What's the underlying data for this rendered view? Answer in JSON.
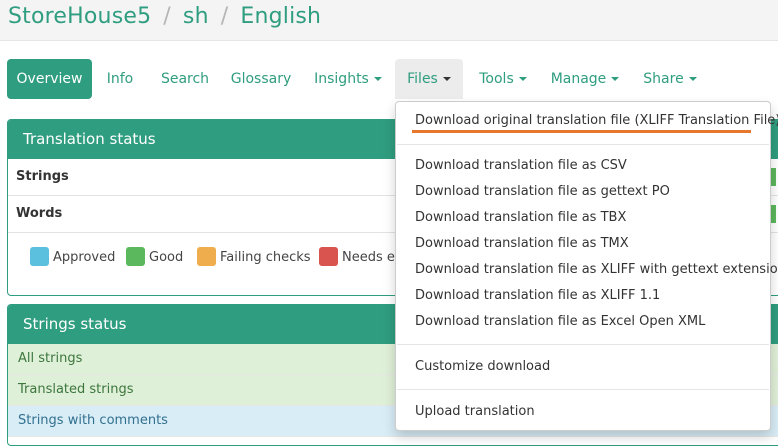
{
  "breadcrumb": {
    "project": "StoreHouse5",
    "component": "sh",
    "language": "English",
    "separator": "/"
  },
  "tabs": [
    {
      "label": "Overview"
    },
    {
      "label": "Info"
    },
    {
      "label": "Search"
    },
    {
      "label": "Glossary"
    },
    {
      "label": "Insights"
    },
    {
      "label": "Files"
    },
    {
      "label": "Tools"
    },
    {
      "label": "Manage"
    },
    {
      "label": "Share"
    }
  ],
  "translation_status": {
    "title": "Translation status",
    "rows": [
      {
        "label": "Strings"
      },
      {
        "label": "Words"
      }
    ],
    "legend": [
      {
        "label": "Approved",
        "color": "#5bc0de"
      },
      {
        "label": "Good",
        "color": "#5cb85c"
      },
      {
        "label": "Failing checks",
        "color": "#f0ad4e"
      },
      {
        "label": "Needs ed",
        "color": "#d9534f"
      }
    ]
  },
  "strings_status": {
    "title": "Strings status",
    "rows": [
      {
        "label": "All strings"
      },
      {
        "label": "Translated strings"
      },
      {
        "label": "Strings with comments"
      }
    ]
  },
  "files_menu": {
    "items": [
      "Download original translation file (XLIFF Translation File)",
      "Download translation file as CSV",
      "Download translation file as gettext PO",
      "Download translation file as TBX",
      "Download translation file as TMX",
      "Download translation file as XLIFF with gettext extensions",
      "Download translation file as XLIFF 1.1",
      "Download translation file as Excel Open XML",
      "Customize download",
      "Upload translation"
    ],
    "highlight_color": "#e8772e"
  },
  "colors": {
    "accent": "#2f9d7f"
  }
}
